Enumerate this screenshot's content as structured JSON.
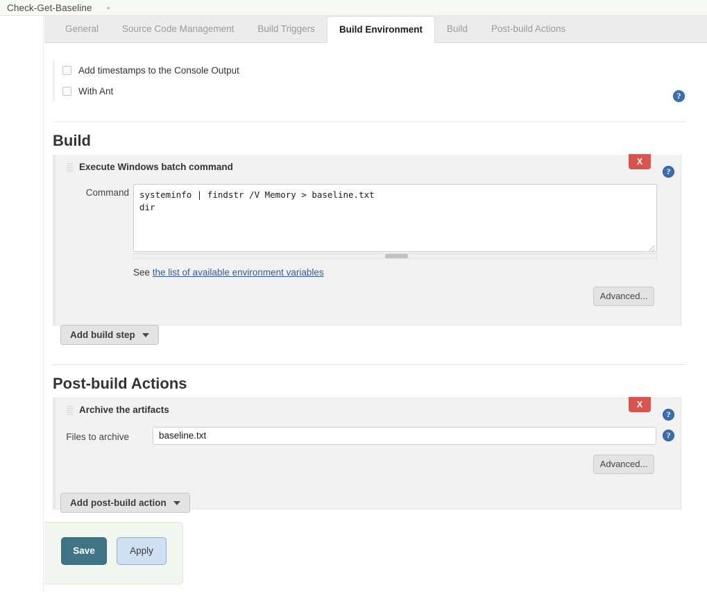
{
  "breadcrumb": {
    "item": "Check-Get-Baseline",
    "caret_icon": "chevron-right-icon"
  },
  "tabs": [
    {
      "label": "General",
      "active": false
    },
    {
      "label": "Source Code Management",
      "active": false
    },
    {
      "label": "Build Triggers",
      "active": false
    },
    {
      "label": "Build Environment",
      "active": true
    },
    {
      "label": "Build",
      "active": false
    },
    {
      "label": "Post-build Actions",
      "active": false
    }
  ],
  "build_environment": {
    "checkboxes": [
      {
        "label": "Add timestamps to the Console Output",
        "checked": false
      },
      {
        "label": "With Ant",
        "checked": false
      }
    ],
    "help_icon": "help-icon"
  },
  "build_section": {
    "heading": "Build",
    "step": {
      "title": "Execute Windows batch command",
      "drag_handle_icon": "drag-handle-icon",
      "delete_label": "X",
      "help_icon": "help-icon",
      "command_label": "Command",
      "command_value": "systeminfo | findstr /V Memory > baseline.txt\ndir",
      "see_prefix": "See ",
      "see_link": "the list of available environment variables",
      "advanced_label": "Advanced..."
    },
    "add_button_label": "Add build step",
    "add_button_caret": "chevron-down-icon"
  },
  "postbuild_section": {
    "heading": "Post-build Actions",
    "action": {
      "title": "Archive the artifacts",
      "drag_handle_icon": "drag-handle-icon",
      "delete_label": "X",
      "help_icon": "help-icon",
      "files_label": "Files to archive",
      "files_value": "baseline.txt",
      "advanced_label": "Advanced..."
    },
    "add_button_label": "Add post-build action",
    "add_button_caret": "chevron-down-icon"
  },
  "footer": {
    "save_label": "Save",
    "apply_label": "Apply"
  },
  "colors": {
    "accent_save": "#3f7487",
    "apply": "#cfe0f2",
    "danger": "#d9534f",
    "help_blue": "#3b6fb0",
    "link": "#2b5f9e"
  }
}
